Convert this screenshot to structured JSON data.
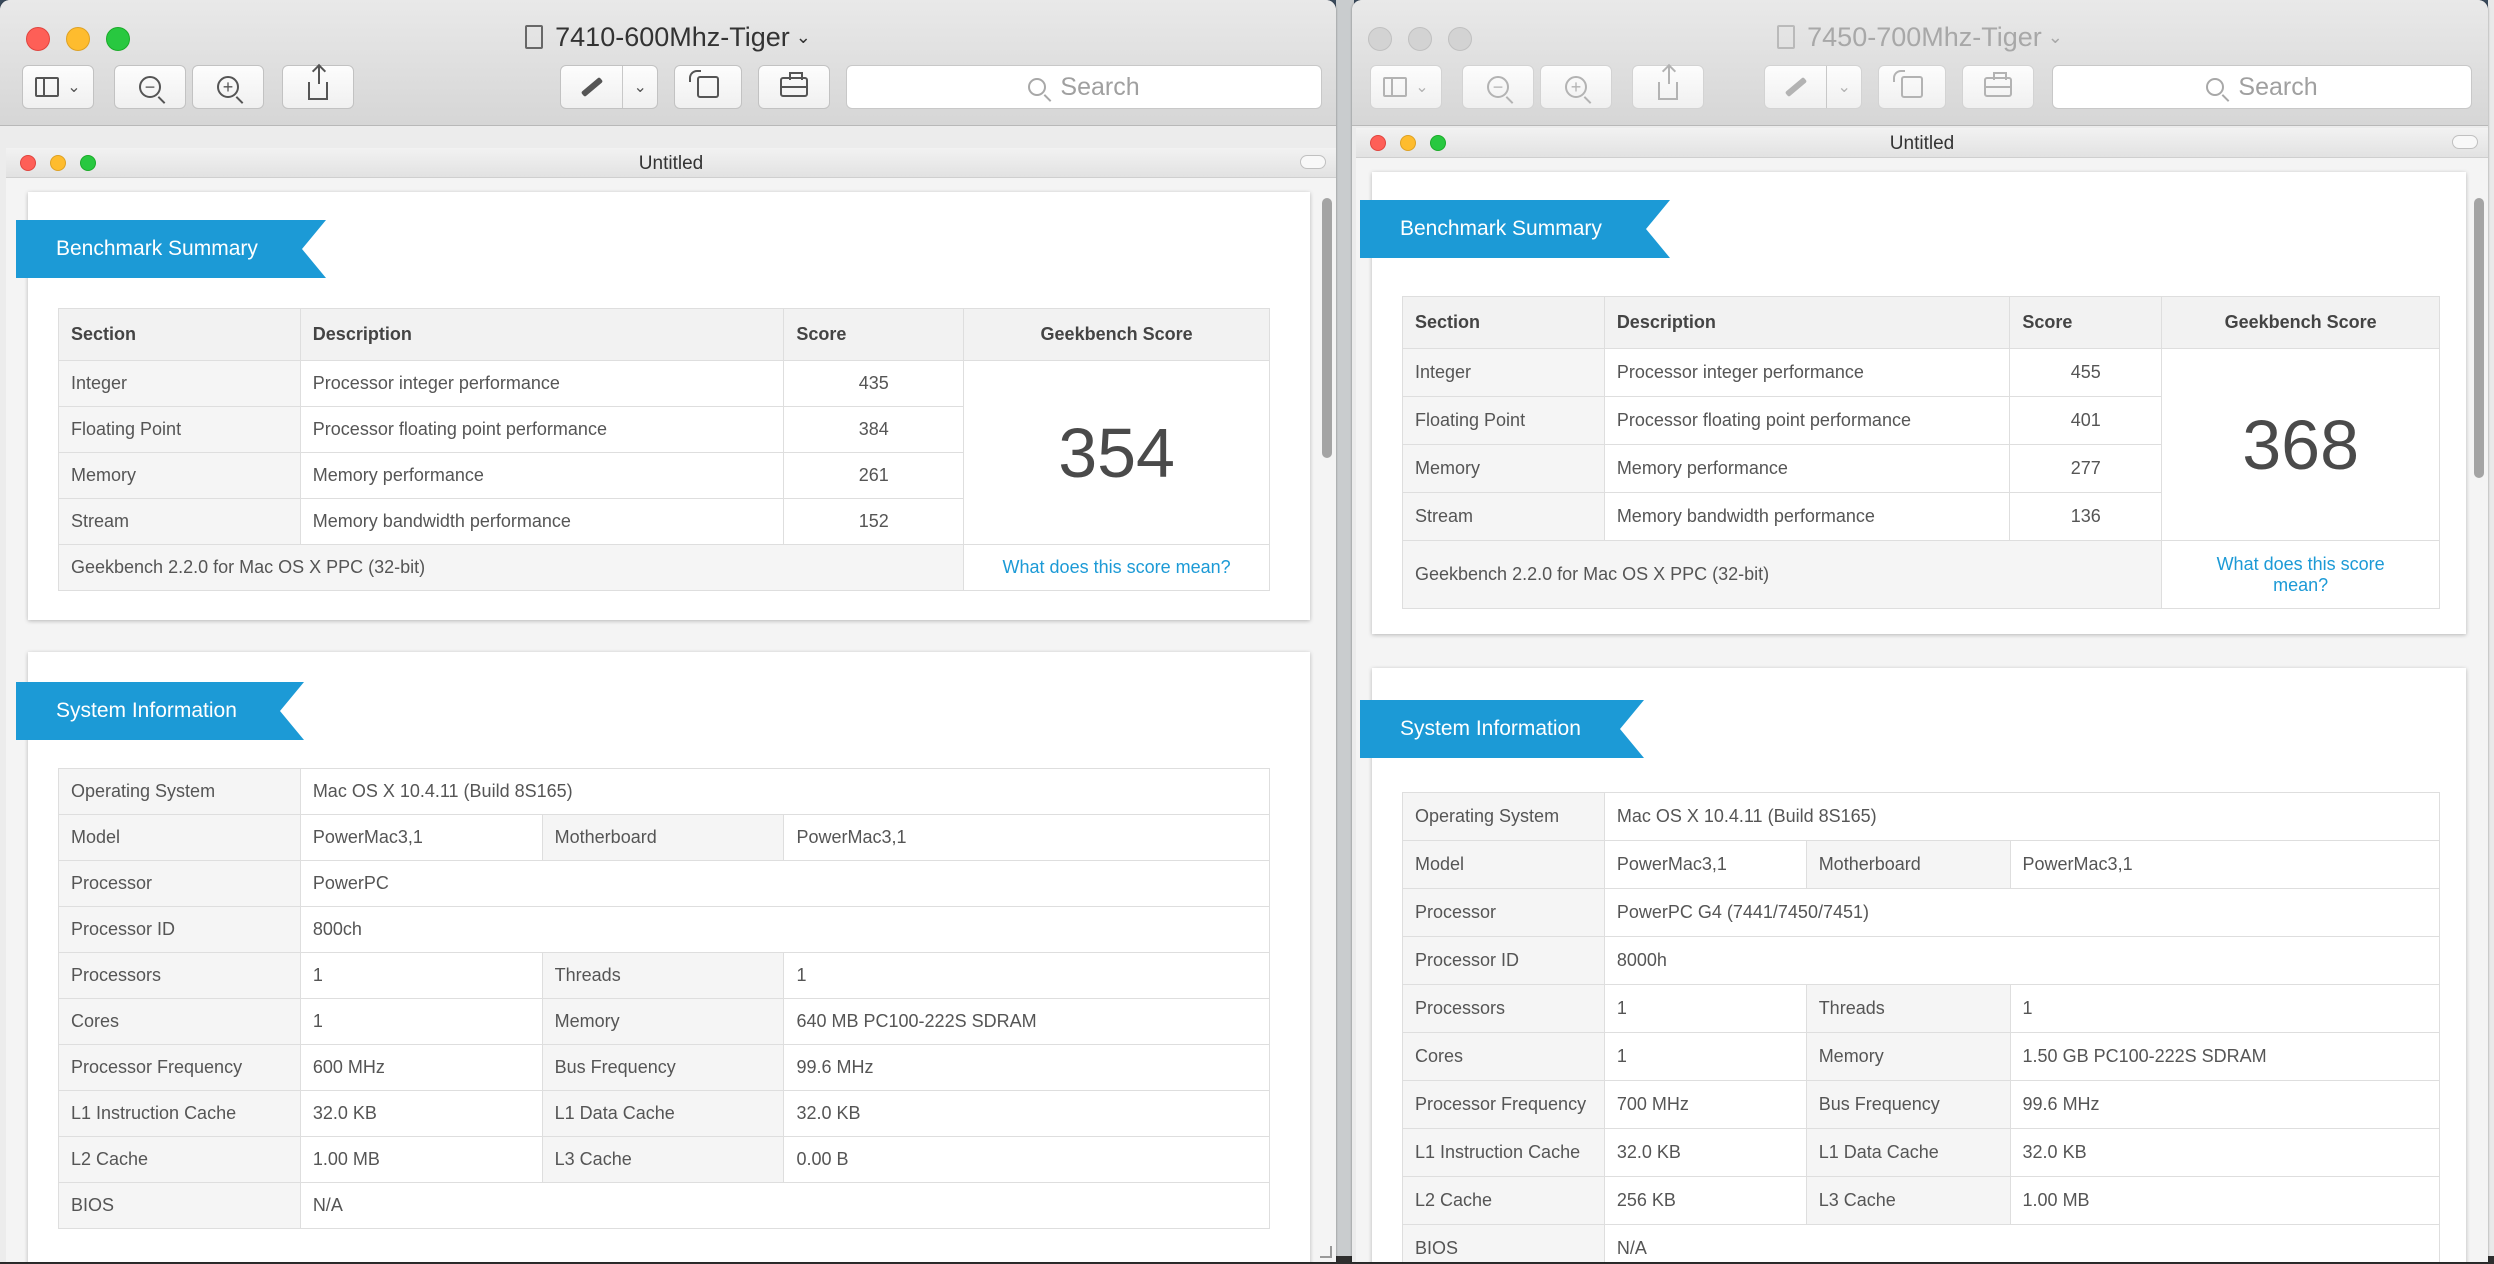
{
  "left_window": {
    "title": "7410-600Mhz-Tiger",
    "search_placeholder": "Search",
    "doc_title": "Untitled",
    "summary": {
      "heading": "Benchmark Summary",
      "columns": [
        "Section",
        "Description",
        "Score",
        "Geekbench Score"
      ],
      "rows": [
        {
          "section": "Integer",
          "description": "Processor integer performance",
          "score": "435"
        },
        {
          "section": "Floating Point",
          "description": "Processor floating point performance",
          "score": "384"
        },
        {
          "section": "Memory",
          "description": "Memory performance",
          "score": "261"
        },
        {
          "section": "Stream",
          "description": "Memory bandwidth performance",
          "score": "152"
        }
      ],
      "geekbench_score": "354",
      "footer": "Geekbench 2.2.0 for Mac OS X PPC (32-bit)",
      "link": "What does this score mean?"
    },
    "sysinfo": {
      "heading": "System Information",
      "os_label": "Operating System",
      "os": "Mac OS X 10.4.11 (Build 8S165)",
      "model_label": "Model",
      "model": "PowerMac3,1",
      "motherboard_label": "Motherboard",
      "motherboard": "PowerMac3,1",
      "processor_label": "Processor",
      "processor": "PowerPC",
      "processor_id_label": "Processor ID",
      "processor_id": "800ch",
      "processors_label": "Processors",
      "processors": "1",
      "threads_label": "Threads",
      "threads": "1",
      "cores_label": "Cores",
      "cores": "1",
      "memory_label": "Memory",
      "memory": "640 MB PC100-222S SDRAM",
      "freq_label": "Processor Frequency",
      "freq": "600 MHz",
      "bus_label": "Bus Frequency",
      "bus": "99.6 MHz",
      "l1i_label": "L1 Instruction Cache",
      "l1i": "32.0 KB",
      "l1d_label": "L1 Data Cache",
      "l1d": "32.0 KB",
      "l2_label": "L2 Cache",
      "l2": "1.00 MB",
      "l3_label": "L3 Cache",
      "l3": "0.00 B",
      "bios_label": "BIOS",
      "bios": "N/A"
    }
  },
  "right_window": {
    "title": "7450-700Mhz-Tiger",
    "search_placeholder": "Search",
    "doc_title": "Untitled",
    "summary": {
      "heading": "Benchmark Summary",
      "columns": [
        "Section",
        "Description",
        "Score",
        "Geekbench Score"
      ],
      "rows": [
        {
          "section": "Integer",
          "description": "Processor integer performance",
          "score": "455"
        },
        {
          "section": "Floating Point",
          "description": "Processor floating point performance",
          "score": "401"
        },
        {
          "section": "Memory",
          "description": "Memory performance",
          "score": "277"
        },
        {
          "section": "Stream",
          "description": "Memory bandwidth performance",
          "score": "136"
        }
      ],
      "geekbench_score": "368",
      "footer": "Geekbench 2.2.0 for Mac OS X PPC (32-bit)",
      "link": "What does this score mean?"
    },
    "sysinfo": {
      "heading": "System Information",
      "os_label": "Operating System",
      "os": "Mac OS X 10.4.11 (Build 8S165)",
      "model_label": "Model",
      "model": "PowerMac3,1",
      "motherboard_label": "Motherboard",
      "motherboard": "PowerMac3,1",
      "processor_label": "Processor",
      "processor": "PowerPC G4 (7441/7450/7451)",
      "processor_id_label": "Processor ID",
      "processor_id": "8000h",
      "processors_label": "Processors",
      "processors": "1",
      "threads_label": "Threads",
      "threads": "1",
      "cores_label": "Cores",
      "cores": "1",
      "memory_label": "Memory",
      "memory": "1.50 GB PC100-222S SDRAM",
      "freq_label": "Processor Frequency",
      "freq": "700 MHz",
      "bus_label": "Bus Frequency",
      "bus": "99.6 MHz",
      "l1i_label": "L1 Instruction Cache",
      "l1i": "32.0 KB",
      "l1d_label": "L1 Data Cache",
      "l1d": "32.0 KB",
      "l2_label": "L2 Cache",
      "l2": "256 KB",
      "l3_label": "L3 Cache",
      "l3": "1.00 MB",
      "bios_label": "BIOS",
      "bios": "N/A"
    }
  },
  "colors": {
    "accent": "#1c9ad6",
    "close": "#fe5f57",
    "minimize": "#febc2e",
    "zoom": "#28c840"
  }
}
